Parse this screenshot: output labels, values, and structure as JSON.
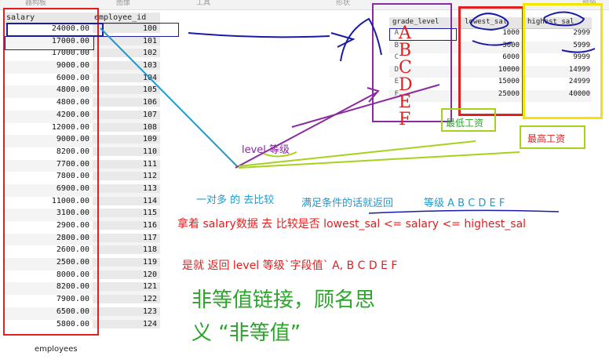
{
  "toolbar": {
    "items": [
      "器构板",
      "图像",
      "工具",
      "形状",
      "颜色"
    ]
  },
  "employees_grid": {
    "headers": [
      "salary",
      "employee_id"
    ],
    "rows": [
      [
        "24000.00",
        "100"
      ],
      [
        "17000.00",
        "101"
      ],
      [
        "17000.00",
        "102"
      ],
      [
        "9000.00",
        "103"
      ],
      [
        "6000.00",
        "104"
      ],
      [
        "4800.00",
        "105"
      ],
      [
        "4800.00",
        "106"
      ],
      [
        "4200.00",
        "107"
      ],
      [
        "12000.00",
        "108"
      ],
      [
        "9000.00",
        "109"
      ],
      [
        "8200.00",
        "110"
      ],
      [
        "7700.00",
        "111"
      ],
      [
        "7800.00",
        "112"
      ],
      [
        "6900.00",
        "113"
      ],
      [
        "11000.00",
        "114"
      ],
      [
        "3100.00",
        "115"
      ],
      [
        "2900.00",
        "116"
      ],
      [
        "2800.00",
        "117"
      ],
      [
        "2600.00",
        "118"
      ],
      [
        "2500.00",
        "119"
      ],
      [
        "8000.00",
        "120"
      ],
      [
        "8200.00",
        "121"
      ],
      [
        "7900.00",
        "122"
      ],
      [
        "6500.00",
        "123"
      ],
      [
        "5800.00",
        "124"
      ]
    ],
    "caption": "employees"
  },
  "job_grades_grid": {
    "headers": [
      "grade_level",
      "lowest_sal",
      "highest_sal"
    ],
    "rows": [
      [
        "A",
        "1000",
        "2999"
      ],
      [
        "B",
        "3000",
        "5999"
      ],
      [
        "C",
        "6000",
        "9999"
      ],
      [
        "D",
        "10000",
        "14999"
      ],
      [
        "E",
        "15000",
        "24999"
      ],
      [
        "F",
        "25000",
        "40000"
      ]
    ],
    "handwritten_letters": [
      "A",
      "B",
      "C",
      "D",
      "E",
      "F"
    ]
  },
  "annotations": {
    "lowest_label": "最低工资",
    "highest_label": "最高工资",
    "level_label": "level  等级",
    "one_to_many": "一对多  的  去比较",
    "return_if": "满足条件的话就返回",
    "grade_letters": "等级  A B C D E F",
    "compare_line": "拿着 salary数据 去 比较是否   lowest_sal  <=  salary  <=  highest_sal",
    "is_return": "是就   返回    level 等级`字段值`        A, B C D E F",
    "big_line1": "非等值链接，顾名思",
    "big_line2": "义   “非等值”"
  },
  "colors": {
    "red": "#e02020",
    "blue": "#1a1aa8",
    "purple": "#8a2aa0",
    "yellow": "#f2e600",
    "lime": "#a6d21e",
    "green": "#2aa52a",
    "cyan": "#1e9ad2"
  }
}
